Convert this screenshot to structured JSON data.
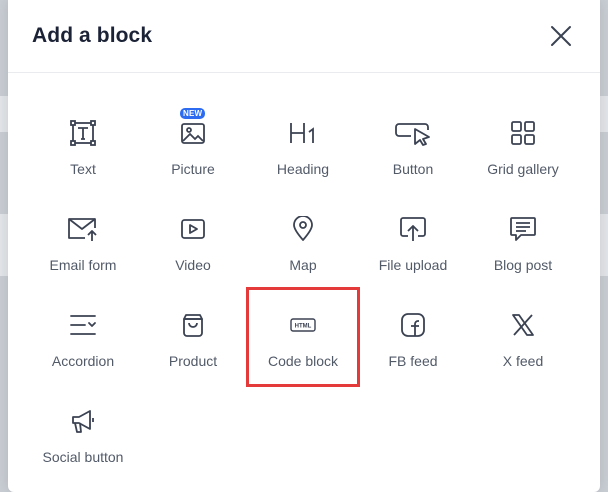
{
  "dialog": {
    "title": "Add a block"
  },
  "blocks": [
    {
      "label": "Text",
      "icon": "text-icon"
    },
    {
      "label": "Picture",
      "icon": "picture-icon",
      "badge": "NEW"
    },
    {
      "label": "Heading",
      "icon": "heading-icon"
    },
    {
      "label": "Button",
      "icon": "button-icon"
    },
    {
      "label": "Grid gallery",
      "icon": "grid-gallery-icon"
    },
    {
      "label": "Email form",
      "icon": "email-form-icon"
    },
    {
      "label": "Video",
      "icon": "video-icon"
    },
    {
      "label": "Map",
      "icon": "map-pin-icon"
    },
    {
      "label": "File upload",
      "icon": "file-upload-icon"
    },
    {
      "label": "Blog post",
      "icon": "blog-post-icon"
    },
    {
      "label": "Accordion",
      "icon": "accordion-icon"
    },
    {
      "label": "Product",
      "icon": "product-bag-icon"
    },
    {
      "label": "Code block",
      "icon": "html-code-icon",
      "icon_text": "HTML",
      "highlighted": true
    },
    {
      "label": "FB feed",
      "icon": "facebook-icon"
    },
    {
      "label": "X feed",
      "icon": "x-logo-icon"
    },
    {
      "label": "Social button",
      "icon": "megaphone-icon"
    }
  ],
  "colors": {
    "title": "#1c2337",
    "label": "#525a68",
    "icon": "#3b4252",
    "highlight": "#e53a3a",
    "badge": "#2d6cf0"
  }
}
